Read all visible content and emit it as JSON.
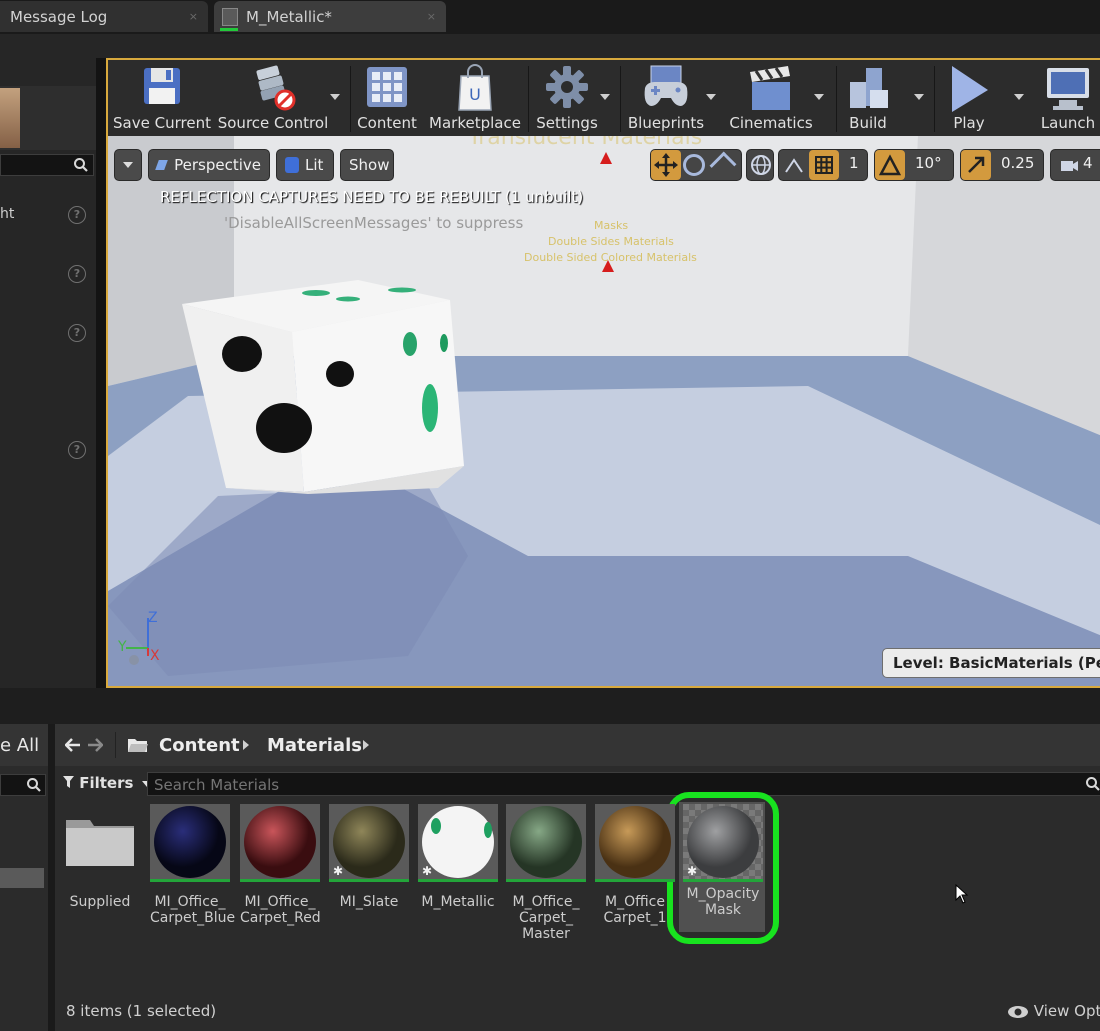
{
  "tabs": [
    {
      "label": "Message Log",
      "close": "×"
    },
    {
      "label": "M_Metallic*",
      "close": "×"
    }
  ],
  "details_panel": {
    "rows": [
      "ht"
    ],
    "help_icon": "?"
  },
  "toolbar": {
    "buttons": [
      {
        "label": "Save Current",
        "icon": "floppy-disk-icon"
      },
      {
        "label": "Source Control",
        "icon": "source-control-icon"
      },
      {
        "label": "Content",
        "icon": "content-grid-icon"
      },
      {
        "label": "Marketplace",
        "icon": "marketplace-bag-icon"
      },
      {
        "label": "Settings",
        "icon": "gear-icon"
      },
      {
        "label": "Blueprints",
        "icon": "gamepad-icon"
      },
      {
        "label": "Cinematics",
        "icon": "clapperboard-icon"
      },
      {
        "label": "Build",
        "icon": "build-blocks-icon"
      },
      {
        "label": "Play",
        "icon": "play-icon"
      },
      {
        "label": "Launch",
        "icon": "monitor-icon"
      }
    ]
  },
  "viewport": {
    "perspective_label": "Perspective",
    "lit_label": "Lit",
    "show_label": "Show",
    "grid_value": "1",
    "rotation_value": "10°",
    "scale_value": "0.25",
    "camera_speed": "4",
    "warning_message": "REFLECTION CAPTURES NEED TO BE REBUILT (1 unbuilt)",
    "suppress_message": "'DisableAllScreenMessages' to suppress",
    "scene_text": [
      "Masks",
      "Double Sides Materials",
      "Double Sided Colored Materials"
    ],
    "axis_labels": {
      "z": "Z",
      "y": "Y",
      "x": "X"
    },
    "level_label": "Level:  BasicMaterials (Persist"
  },
  "content_browser": {
    "left_header": "e All",
    "breadcrumb": [
      "Content",
      "Materials"
    ],
    "filters_label": "Filters",
    "search_placeholder": "Search Materials",
    "assets": [
      {
        "label": "Supplied",
        "kind": "folder"
      },
      {
        "label": "MI_Office_\nCarpet_Blue",
        "kind": "material"
      },
      {
        "label": "MI_Office_\nCarpet_Red",
        "kind": "material"
      },
      {
        "label": "MI_Slate",
        "kind": "material"
      },
      {
        "label": "M_Metallic",
        "kind": "material"
      },
      {
        "label": "M_Office_\nCarpet_\nMaster",
        "kind": "material"
      },
      {
        "label": "M_Office\nCarpet_1",
        "kind": "material"
      },
      {
        "label": "M_Opacity\nMask",
        "kind": "material"
      }
    ],
    "status": "8 items (1 selected)",
    "view_options": "View Optio"
  },
  "colors": {
    "accent_orange": "#d8a93d",
    "highlight_green": "#18e21f"
  }
}
